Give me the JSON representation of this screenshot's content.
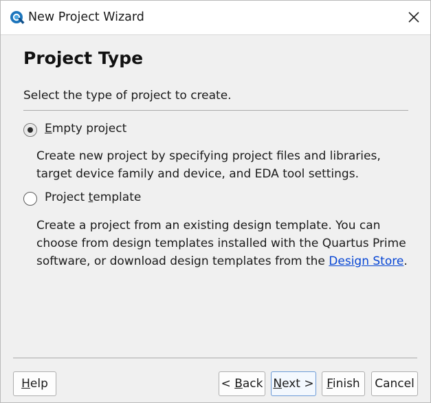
{
  "window": {
    "title": "New Project Wizard",
    "icon": "quartus-app-icon",
    "close_icon": "close-icon"
  },
  "page": {
    "title": "Project Type",
    "instruction": "Select the type of project to create."
  },
  "options": [
    {
      "label_pre": "",
      "label_mnemonic": "E",
      "label_post": "mpty project",
      "checked": true,
      "description": "Create new project by specifying project files and libraries, target device family and device, and EDA tool settings."
    },
    {
      "label_pre": "Project ",
      "label_mnemonic": "t",
      "label_post": "emplate",
      "checked": false,
      "description_before_link": "Create a project from an existing design template. You can choose from design templates installed with the Quartus Prime software, or download design templates from the ",
      "description_link": "Design Store",
      "description_after_link": "."
    }
  ],
  "buttons": {
    "help": {
      "mnemonic": "H",
      "rest": "elp"
    },
    "back": {
      "pre": "< ",
      "mnemonic": "B",
      "rest": "ack"
    },
    "next": {
      "mnemonic": "N",
      "rest": "ext >"
    },
    "finish": {
      "mnemonic": "F",
      "rest": "inish"
    },
    "cancel": {
      "label": "Cancel"
    }
  },
  "colors": {
    "link": "#0645d4",
    "default_button_border": "#6b9ad6",
    "background": "#f0f0f0"
  }
}
